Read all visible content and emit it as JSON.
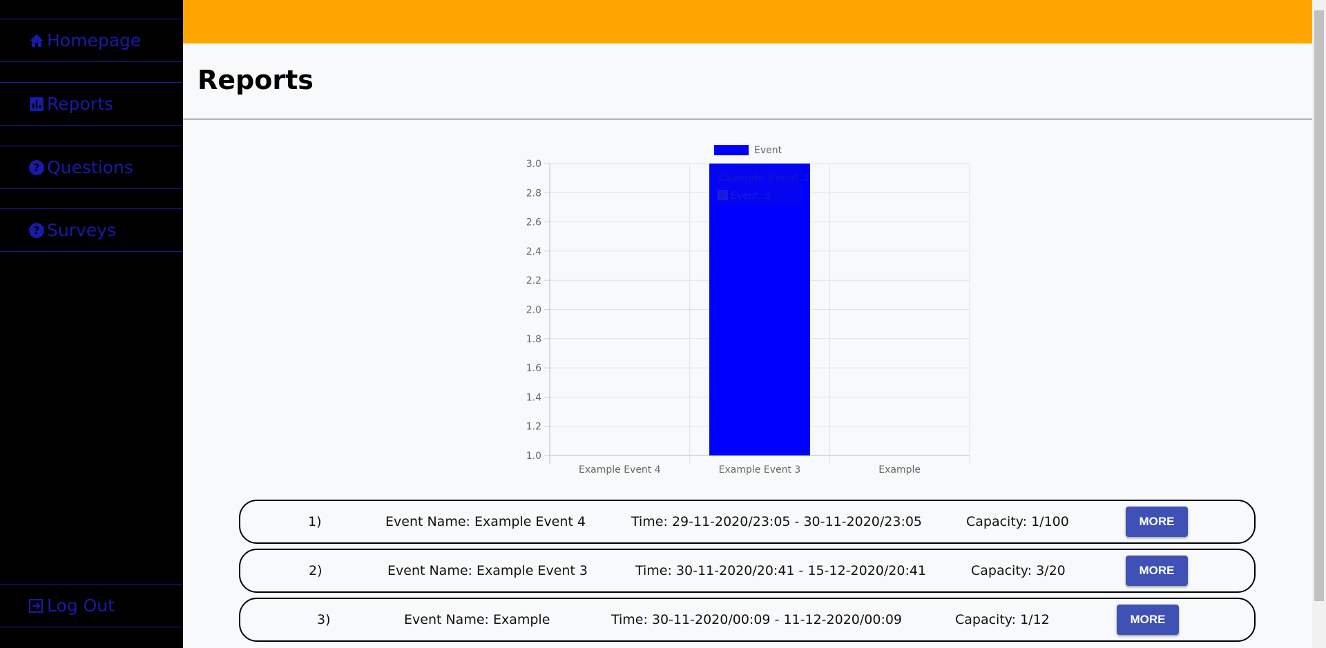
{
  "sidebar": {
    "items": [
      {
        "label": "Homepage",
        "icon": "home-icon"
      },
      {
        "label": "Reports",
        "icon": "bar-chart-icon"
      },
      {
        "label": "Questions",
        "icon": "question-icon"
      },
      {
        "label": "Surveys",
        "icon": "question-icon"
      }
    ],
    "logout": {
      "label": "Log Out",
      "icon": "logout-icon"
    }
  },
  "page": {
    "title": "Reports"
  },
  "chart_data": {
    "type": "bar",
    "categories": [
      "Example Event 4",
      "Example Event 3",
      "Example"
    ],
    "series": [
      {
        "name": "Event",
        "values": [
          1,
          3,
          1
        ],
        "color": "#0000ff"
      }
    ],
    "ylim": [
      1.0,
      3.0
    ],
    "yticks": [
      "1.0",
      "1.2",
      "1.4",
      "1.6",
      "1.8",
      "2.0",
      "2.2",
      "2.4",
      "2.6",
      "2.8",
      "3.0"
    ],
    "legend": "top",
    "grid": true,
    "tooltip": {
      "title": "Example Event 3",
      "label": "Event: 3"
    }
  },
  "events": [
    {
      "index": "1)",
      "name": "Event Name: Example Event 4",
      "time": "Time: 29-11-2020/23:05 - 30-11-2020/23:05",
      "capacity": "Capacity: 1/100",
      "button": "MORE"
    },
    {
      "index": "2)",
      "name": "Event Name: Example Event 3",
      "time": "Time: 30-11-2020/20:41 - 15-12-2020/20:41",
      "capacity": "Capacity: 3/20",
      "button": "MORE"
    },
    {
      "index": "3)",
      "name": "Event Name: Example",
      "time": "Time: 30-11-2020/00:09 - 11-12-2020/00:09",
      "capacity": "Capacity: 1/12",
      "button": "MORE"
    }
  ],
  "colors": {
    "topbar": "#ffa500",
    "sidebar": "#000000",
    "nav_text": "#1a1aa8",
    "button": "#3f51b5",
    "bar": "#0000ff"
  }
}
